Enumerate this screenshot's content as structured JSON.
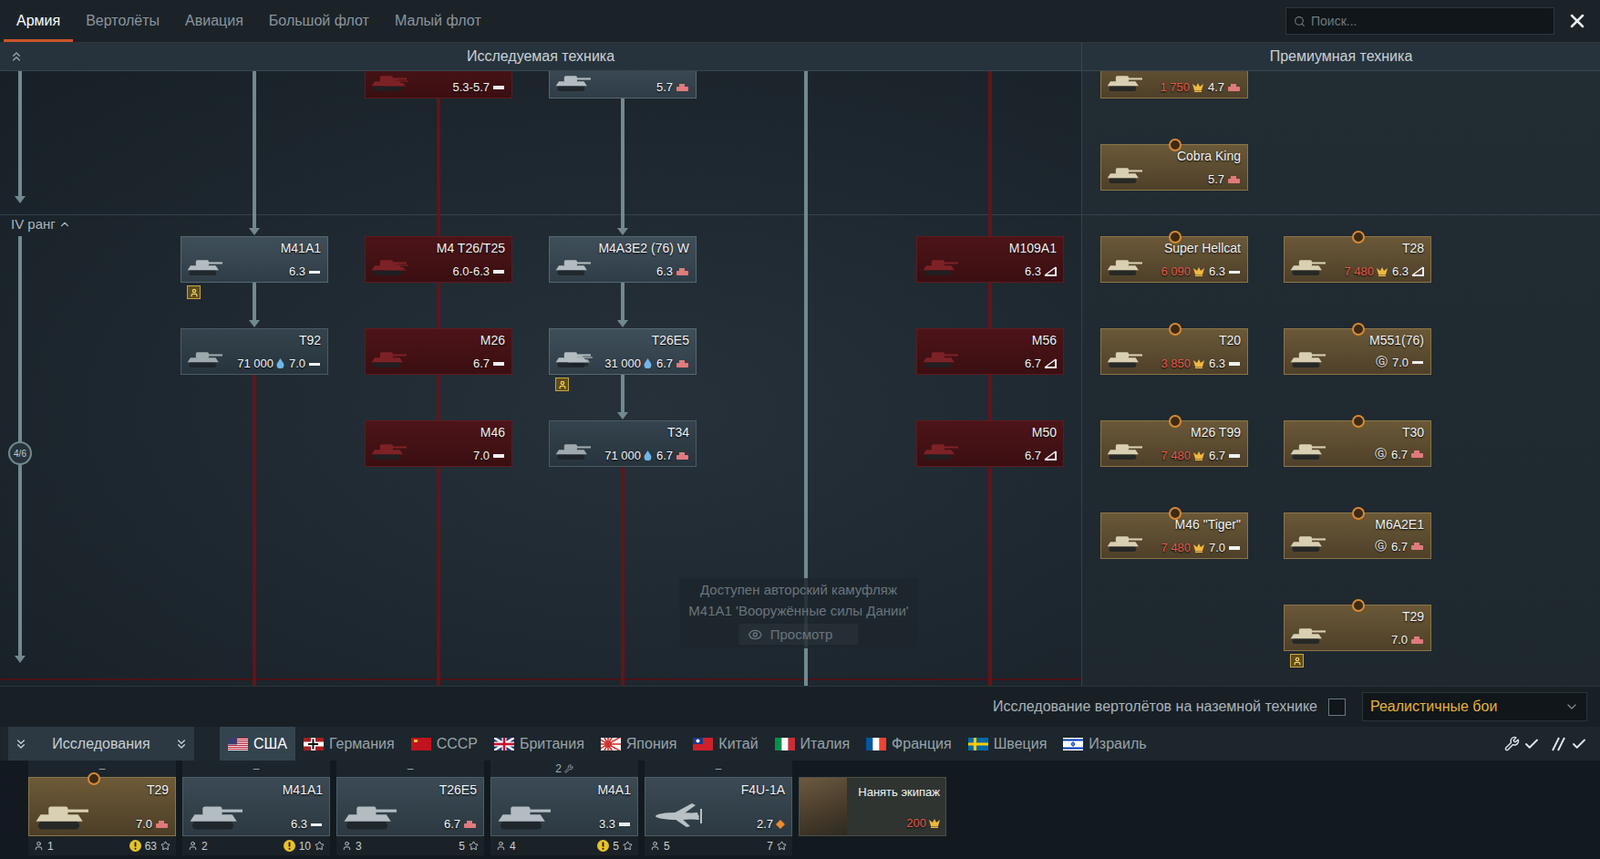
{
  "topTabs": [
    {
      "label": "Армия",
      "selected": true
    },
    {
      "label": "Вертолёты",
      "selected": false
    },
    {
      "label": "Авиация",
      "selected": false
    },
    {
      "label": "Большой флот",
      "selected": false
    },
    {
      "label": "Малый флот",
      "selected": false
    }
  ],
  "search": {
    "placeholder": "Поиск..."
  },
  "sections": {
    "research": "Исследуемая техника",
    "premium": "Премиумная техника"
  },
  "rank": {
    "label": "IV ранг",
    "progress": "4/6",
    "expanded": true
  },
  "researchColumns": [
    {
      "above": "open",
      "below": "locked",
      "rank3": [],
      "rank4": [
        {
          "name": "M41A1",
          "br": "6.3",
          "kind": "light",
          "status": "owned",
          "clipped": false,
          "group": false,
          "marker": false,
          "badge": true
        },
        {
          "name": "T92",
          "br": "7.0",
          "kind": "light",
          "status": "available",
          "cost": "71 000",
          "costKind": "rp",
          "clipped": false,
          "group": false,
          "marker": false,
          "badge": false
        }
      ]
    },
    {
      "above": "none",
      "below": "locked",
      "rank3": [
        {
          "name": "",
          "br": "5.3-5.7",
          "kind": "medium",
          "status": "locked",
          "clipped": true,
          "group": true,
          "marker": false,
          "badge": false
        }
      ],
      "rank4": [
        {
          "name": "M4 T26/T25",
          "br": "6.0-6.3",
          "kind": "medium",
          "status": "locked",
          "clipped": false,
          "group": true,
          "marker": false,
          "badge": false
        },
        {
          "name": "M26",
          "br": "6.7",
          "kind": "medium",
          "status": "locked",
          "clipped": false,
          "group": false,
          "marker": false,
          "badge": false
        },
        {
          "name": "M46",
          "br": "7.0",
          "kind": "medium",
          "status": "locked",
          "clipped": false,
          "group": false,
          "marker": false,
          "badge": false
        }
      ]
    },
    {
      "above": "none",
      "below": "locked",
      "rank3": [
        {
          "name": "",
          "br": "5.7",
          "kind": "heavy",
          "status": "owned",
          "clipped": true,
          "group": false,
          "marker": false,
          "badge": false
        }
      ],
      "rank4": [
        {
          "name": "M4A3E2 (76) W",
          "br": "6.3",
          "kind": "heavy",
          "status": "owned",
          "clipped": false,
          "group": false,
          "marker": false,
          "badge": false
        },
        {
          "name": "T26E5",
          "br": "6.7",
          "kind": "heavy",
          "status": "owned",
          "cost": "31 000",
          "costKind": "rp",
          "clipped": false,
          "group": true,
          "marker": false,
          "badge": true
        },
        {
          "name": "T34",
          "br": "6.7",
          "kind": "heavy",
          "status": "available",
          "cost": "71 000",
          "costKind": "rp",
          "clipped": false,
          "group": false,
          "marker": false,
          "badge": false
        }
      ]
    },
    {
      "above": "open",
      "below": "open",
      "rank3": [],
      "rank4": []
    },
    {
      "above": "locked",
      "below": "locked",
      "rank3": [],
      "rank4": [
        {
          "name": "M109A1",
          "br": "6.3",
          "kind": "destroyer",
          "status": "locked",
          "clipped": false,
          "group": false,
          "marker": false,
          "badge": false
        },
        {
          "name": "M56",
          "br": "6.7",
          "kind": "destroyer",
          "status": "locked",
          "clipped": false,
          "group": false,
          "marker": false,
          "badge": false
        },
        {
          "name": "M50",
          "br": "6.7",
          "kind": "destroyer",
          "status": "locked",
          "clipped": false,
          "group": false,
          "marker": false,
          "badge": false
        }
      ]
    }
  ],
  "premiumColumns": [
    {
      "rank3": [
        {
          "name": "",
          "br": "4.7",
          "kind": "heavy",
          "status": "premium",
          "cost": "1 750",
          "costKind": "ge",
          "affordable": false,
          "clipped": true,
          "group": false,
          "marker": false,
          "badge": false
        },
        {
          "name": "Cobra King",
          "br": "5.7",
          "kind": "heavy",
          "status": "premium",
          "clipped": false,
          "group": false,
          "marker": true,
          "badge": false
        }
      ],
      "rank4": [
        {
          "name": "Super Hellcat",
          "br": "6.3",
          "kind": "light",
          "status": "premium",
          "cost": "6 090",
          "costKind": "ge",
          "affordable": false,
          "clipped": false,
          "group": false,
          "marker": true,
          "badge": false
        },
        {
          "name": "T20",
          "br": "6.3",
          "kind": "medium",
          "status": "premium",
          "cost": "3 850",
          "costKind": "ge",
          "affordable": false,
          "clipped": false,
          "group": false,
          "marker": true,
          "badge": false
        },
        {
          "name": "M26 T99",
          "br": "6.7",
          "kind": "medium",
          "status": "premium",
          "cost": "7 480",
          "costKind": "ge",
          "affordable": false,
          "clipped": false,
          "group": false,
          "marker": true,
          "badge": false
        },
        {
          "name": "M46 \"Tiger\"",
          "br": "7.0",
          "kind": "medium",
          "status": "premium",
          "cost": "7 480",
          "costKind": "ge",
          "affordable": false,
          "clipped": false,
          "group": false,
          "marker": true,
          "badge": false
        }
      ]
    },
    {
      "rank3": [],
      "rank4": [
        {
          "name": "T28",
          "br": "6.3",
          "kind": "destroyer",
          "status": "premium",
          "cost": "7 480",
          "costKind": "ge",
          "affordable": false,
          "clipped": false,
          "group": false,
          "marker": true,
          "badge": false
        },
        {
          "name": "M551(76)",
          "br": "7.0",
          "kind": "light",
          "status": "premium",
          "cost": "Ⓖ",
          "costKind": "gift",
          "clipped": false,
          "group": false,
          "marker": true,
          "badge": false
        },
        {
          "name": "T30",
          "br": "6.7",
          "kind": "heavy",
          "status": "premium",
          "cost": "Ⓖ",
          "costKind": "gift",
          "clipped": false,
          "group": false,
          "marker": true,
          "badge": false
        },
        {
          "name": "M6A2E1",
          "br": "6.7",
          "kind": "heavy",
          "status": "premium",
          "cost": "Ⓖ",
          "costKind": "gift",
          "clipped": false,
          "group": false,
          "marker": true,
          "badge": false
        },
        {
          "name": "T29",
          "br": "7.0",
          "kind": "heavy",
          "status": "premium",
          "clipped": false,
          "group": false,
          "marker": true,
          "badge": true
        }
      ]
    }
  ],
  "notice": {
    "lines": [
      "Доступен авторский камуфляж",
      "M41A1 'Вооружённые силы Дании'"
    ],
    "button": "Просмотр"
  },
  "helicopterOption": {
    "label": "Исследование вертолётов на наземной технике",
    "checked": false
  },
  "mode": {
    "value": "Реалистичные бои"
  },
  "researchToggle": {
    "label": "Исследования"
  },
  "nations": [
    {
      "label": "США",
      "kind": "usa",
      "selected": true
    },
    {
      "label": "Германия",
      "kind": "germany",
      "selected": false
    },
    {
      "label": "СССР",
      "kind": "ussr",
      "selected": false
    },
    {
      "label": "Британия",
      "kind": "britain",
      "selected": false
    },
    {
      "label": "Япония",
      "kind": "japan",
      "selected": false
    },
    {
      "label": "Китай",
      "kind": "china",
      "selected": false
    },
    {
      "label": "Италия",
      "kind": "italy",
      "selected": false
    },
    {
      "label": "Франция",
      "kind": "france",
      "selected": false
    },
    {
      "label": "Швеция",
      "kind": "sweden",
      "selected": false
    },
    {
      "label": "Израиль",
      "kind": "israel",
      "selected": false
    }
  ],
  "filters": [
    {
      "kind": "repair",
      "checked": true
    },
    {
      "kind": "reserve",
      "checked": true
    }
  ],
  "crew": [
    {
      "header": "–",
      "headerIcon": false,
      "name": "T29",
      "br": "7.0",
      "kind": "heavy",
      "vehicle": "tank",
      "premium": true,
      "marker": true,
      "crew": "1",
      "warning": true,
      "points": "63"
    },
    {
      "header": "–",
      "headerIcon": false,
      "name": "M41A1",
      "br": "6.3",
      "kind": "light",
      "vehicle": "tank",
      "premium": false,
      "marker": false,
      "crew": "2",
      "warning": true,
      "points": "10"
    },
    {
      "header": "–",
      "headerIcon": false,
      "name": "T26E5",
      "br": "6.7",
      "kind": "heavy",
      "vehicle": "tank",
      "premium": false,
      "marker": false,
      "crew": "3",
      "warning": false,
      "points": "5"
    },
    {
      "header": "2",
      "headerIcon": true,
      "name": "M4A1",
      "br": "3.3",
      "kind": "medium",
      "vehicle": "tank",
      "premium": false,
      "marker": false,
      "crew": "4",
      "warning": true,
      "points": "5"
    },
    {
      "header": "–",
      "headerIcon": false,
      "name": "F4U-1A",
      "br": "2.7",
      "kind": "fighter",
      "vehicle": "plane",
      "premium": false,
      "marker": false,
      "crew": "5",
      "warning": false,
      "points": "7"
    }
  ],
  "hire": {
    "label": "Нанять экипаж",
    "cost": "200",
    "affordable": false
  }
}
